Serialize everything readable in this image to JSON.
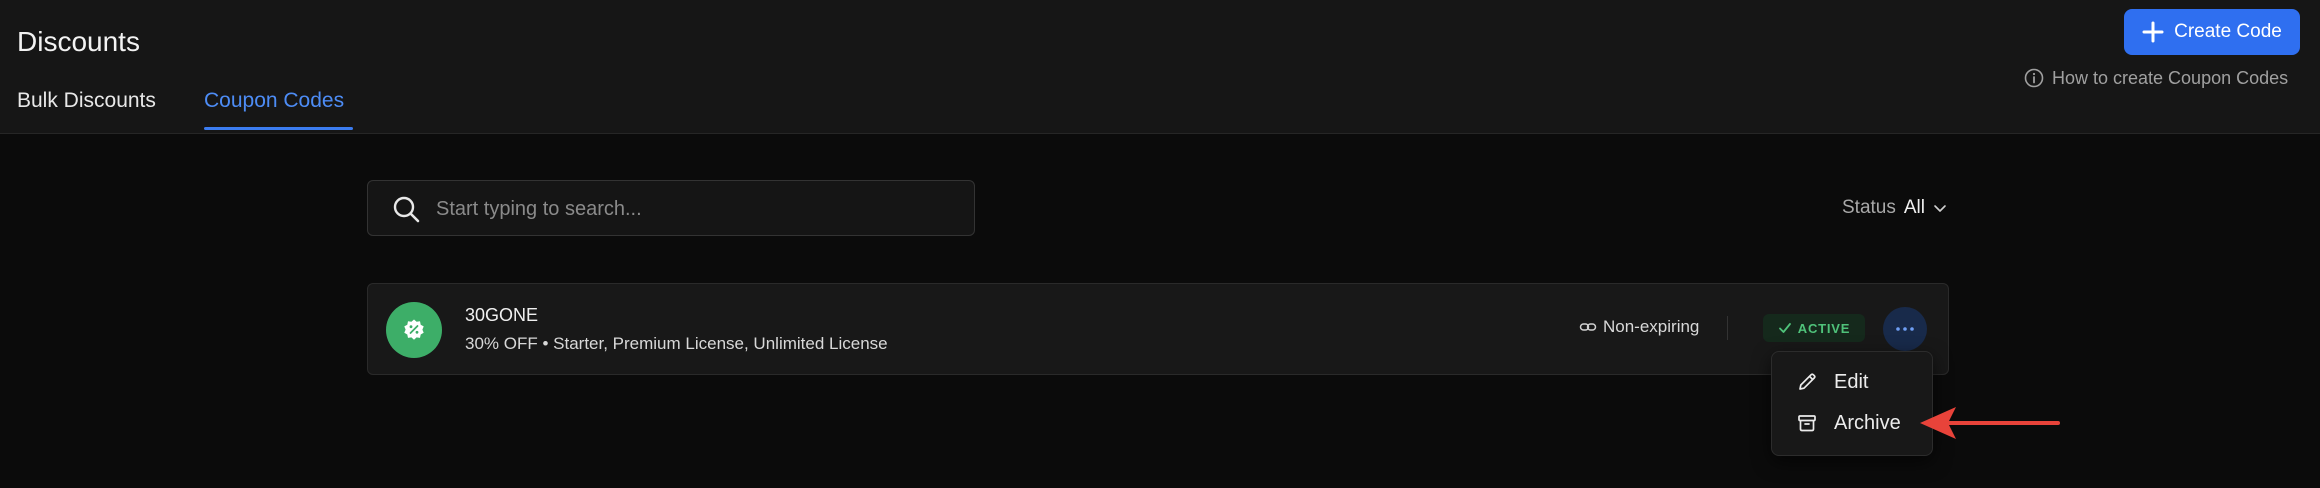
{
  "header": {
    "title": "Discounts",
    "tabs": [
      {
        "label": "Bulk Discounts",
        "active": false
      },
      {
        "label": "Coupon Codes",
        "active": true
      }
    ],
    "create_button": {
      "label": "Create Code",
      "icon": "plus-icon"
    },
    "help_link": {
      "label": "How to create Coupon Codes",
      "icon": "info-icon"
    }
  },
  "search": {
    "placeholder": "Start typing to search...",
    "value": "",
    "icon": "search-icon"
  },
  "filter": {
    "label": "Status",
    "value": "All",
    "icon": "chevron-down-icon"
  },
  "coupons": [
    {
      "code": "30GONE",
      "description": "30% OFF • Starter, Premium License, Unlimited License",
      "expiry": "Non-expiring",
      "status": "ACTIVE",
      "icon": "percent-badge-icon"
    }
  ],
  "menu": {
    "items": [
      {
        "label": "Edit",
        "icon": "pencil-icon"
      },
      {
        "label": "Archive",
        "icon": "archive-icon"
      }
    ]
  },
  "colors": {
    "accent": "#2f6ff0",
    "tab_active": "#4d8cf5",
    "coupon_icon": "#3dae68",
    "status_active": "#4fc27a",
    "annotation_arrow": "#e8433a"
  }
}
